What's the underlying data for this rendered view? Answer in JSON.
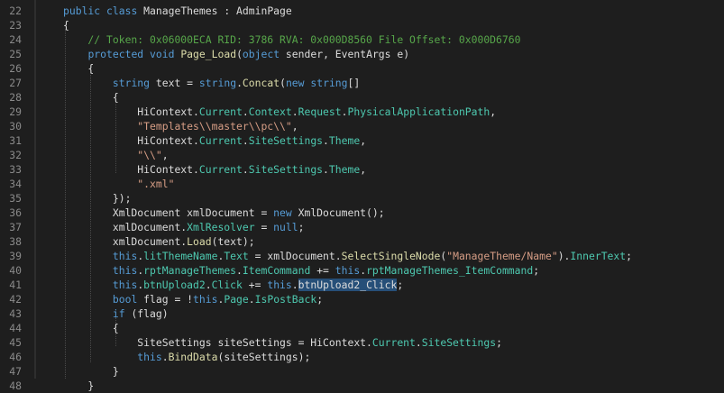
{
  "editor": {
    "line_numbers": [
      "22",
      "23",
      "24",
      "25",
      "26",
      "27",
      "28",
      "29",
      "30",
      "31",
      "32",
      "33",
      "34",
      "35",
      "36",
      "37",
      "38",
      "39",
      "40",
      "41",
      "42",
      "43",
      "44",
      "45",
      "46",
      "47",
      "48"
    ],
    "lines": [
      [
        {
          "c": "kw",
          "t": "public"
        },
        {
          "c": "txt",
          "t": " "
        },
        {
          "c": "kw",
          "t": "class"
        },
        {
          "c": "txt",
          "t": " ManageThemes : AdminPage"
        }
      ],
      [
        {
          "c": "txt",
          "t": "{"
        }
      ],
      [
        {
          "c": "cm",
          "t": "    // Token: 0x06000ECA RID: 3786 RVA: 0x000D8560 File Offset: 0x000D6760"
        }
      ],
      [
        {
          "c": "txt",
          "t": "    "
        },
        {
          "c": "kw",
          "t": "protected"
        },
        {
          "c": "txt",
          "t": " "
        },
        {
          "c": "kw",
          "t": "void"
        },
        {
          "c": "txt",
          "t": " "
        },
        {
          "c": "fn",
          "t": "Page_Load"
        },
        {
          "c": "txt",
          "t": "("
        },
        {
          "c": "kw",
          "t": "object"
        },
        {
          "c": "txt",
          "t": " sender, EventArgs e)"
        }
      ],
      [
        {
          "c": "txt",
          "t": "    {"
        }
      ],
      [
        {
          "c": "txt",
          "t": "        "
        },
        {
          "c": "kw",
          "t": "string"
        },
        {
          "c": "txt",
          "t": " text = "
        },
        {
          "c": "kw",
          "t": "string"
        },
        {
          "c": "txt",
          "t": "."
        },
        {
          "c": "fn",
          "t": "Concat"
        },
        {
          "c": "txt",
          "t": "("
        },
        {
          "c": "kw",
          "t": "new"
        },
        {
          "c": "txt",
          "t": " "
        },
        {
          "c": "kw",
          "t": "string"
        },
        {
          "c": "txt",
          "t": "[]"
        }
      ],
      [
        {
          "c": "txt",
          "t": "        {"
        }
      ],
      [
        {
          "c": "txt",
          "t": "            HiContext."
        },
        {
          "c": "mem",
          "t": "Current"
        },
        {
          "c": "txt",
          "t": "."
        },
        {
          "c": "mem",
          "t": "Context"
        },
        {
          "c": "txt",
          "t": "."
        },
        {
          "c": "mem",
          "t": "Request"
        },
        {
          "c": "txt",
          "t": "."
        },
        {
          "c": "mem",
          "t": "PhysicalApplicationPath"
        },
        {
          "c": "txt",
          "t": ","
        }
      ],
      [
        {
          "c": "txt",
          "t": "            "
        },
        {
          "c": "str",
          "t": "\"Templates\\\\master\\\\pc\\\\\""
        },
        {
          "c": "txt",
          "t": ","
        }
      ],
      [
        {
          "c": "txt",
          "t": "            HiContext."
        },
        {
          "c": "mem",
          "t": "Current"
        },
        {
          "c": "txt",
          "t": "."
        },
        {
          "c": "mem",
          "t": "SiteSettings"
        },
        {
          "c": "txt",
          "t": "."
        },
        {
          "c": "mem",
          "t": "Theme"
        },
        {
          "c": "txt",
          "t": ","
        }
      ],
      [
        {
          "c": "txt",
          "t": "            "
        },
        {
          "c": "str",
          "t": "\"\\\\\""
        },
        {
          "c": "txt",
          "t": ","
        }
      ],
      [
        {
          "c": "txt",
          "t": "            HiContext."
        },
        {
          "c": "mem",
          "t": "Current"
        },
        {
          "c": "txt",
          "t": "."
        },
        {
          "c": "mem",
          "t": "SiteSettings"
        },
        {
          "c": "txt",
          "t": "."
        },
        {
          "c": "mem",
          "t": "Theme"
        },
        {
          "c": "txt",
          "t": ","
        }
      ],
      [
        {
          "c": "txt",
          "t": "            "
        },
        {
          "c": "str",
          "t": "\".xml\""
        }
      ],
      [
        {
          "c": "txt",
          "t": "        });"
        }
      ],
      [
        {
          "c": "txt",
          "t": "        XmlDocument xmlDocument = "
        },
        {
          "c": "kw",
          "t": "new"
        },
        {
          "c": "txt",
          "t": " XmlDocument();"
        }
      ],
      [
        {
          "c": "txt",
          "t": "        xmlDocument."
        },
        {
          "c": "mem",
          "t": "XmlResolver"
        },
        {
          "c": "txt",
          "t": " = "
        },
        {
          "c": "kw",
          "t": "null"
        },
        {
          "c": "txt",
          "t": ";"
        }
      ],
      [
        {
          "c": "txt",
          "t": "        xmlDocument."
        },
        {
          "c": "fn",
          "t": "Load"
        },
        {
          "c": "txt",
          "t": "(text);"
        }
      ],
      [
        {
          "c": "txt",
          "t": "        "
        },
        {
          "c": "kw",
          "t": "this"
        },
        {
          "c": "txt",
          "t": "."
        },
        {
          "c": "mem",
          "t": "litThemeName"
        },
        {
          "c": "txt",
          "t": "."
        },
        {
          "c": "mem",
          "t": "Text"
        },
        {
          "c": "txt",
          "t": " = xmlDocument."
        },
        {
          "c": "fn",
          "t": "SelectSingleNode"
        },
        {
          "c": "txt",
          "t": "("
        },
        {
          "c": "str",
          "t": "\"ManageTheme/Name\""
        },
        {
          "c": "txt",
          "t": ")."
        },
        {
          "c": "mem",
          "t": "InnerText"
        },
        {
          "c": "txt",
          "t": ";"
        }
      ],
      [
        {
          "c": "txt",
          "t": "        "
        },
        {
          "c": "kw",
          "t": "this"
        },
        {
          "c": "txt",
          "t": "."
        },
        {
          "c": "mem",
          "t": "rptManageThemes"
        },
        {
          "c": "txt",
          "t": "."
        },
        {
          "c": "mem",
          "t": "ItemCommand"
        },
        {
          "c": "txt",
          "t": " += "
        },
        {
          "c": "kw",
          "t": "this"
        },
        {
          "c": "txt",
          "t": "."
        },
        {
          "c": "mem",
          "t": "rptManageThemes_ItemCommand"
        },
        {
          "c": "txt",
          "t": ";"
        }
      ],
      [
        {
          "c": "txt",
          "t": "        "
        },
        {
          "c": "kw",
          "t": "this"
        },
        {
          "c": "txt",
          "t": "."
        },
        {
          "c": "mem",
          "t": "btnUpload2"
        },
        {
          "c": "txt",
          "t": "."
        },
        {
          "c": "mem",
          "t": "Click"
        },
        {
          "c": "txt",
          "t": " += "
        },
        {
          "c": "kw",
          "t": "this"
        },
        {
          "c": "txt",
          "t": "."
        },
        {
          "c": "sel",
          "t": "btnUpload2_Click"
        },
        {
          "c": "txt",
          "t": ";"
        }
      ],
      [
        {
          "c": "txt",
          "t": "        "
        },
        {
          "c": "kw",
          "t": "bool"
        },
        {
          "c": "txt",
          "t": " flag = !"
        },
        {
          "c": "kw",
          "t": "this"
        },
        {
          "c": "txt",
          "t": "."
        },
        {
          "c": "mem",
          "t": "Page"
        },
        {
          "c": "txt",
          "t": "."
        },
        {
          "c": "mem",
          "t": "IsPostBack"
        },
        {
          "c": "txt",
          "t": ";"
        }
      ],
      [
        {
          "c": "txt",
          "t": "        "
        },
        {
          "c": "kw",
          "t": "if"
        },
        {
          "c": "txt",
          "t": " (flag)"
        }
      ],
      [
        {
          "c": "txt",
          "t": "        {"
        }
      ],
      [
        {
          "c": "txt",
          "t": "            SiteSettings siteSettings = HiContext."
        },
        {
          "c": "mem",
          "t": "Current"
        },
        {
          "c": "txt",
          "t": "."
        },
        {
          "c": "mem",
          "t": "SiteSettings"
        },
        {
          "c": "txt",
          "t": ";"
        }
      ],
      [
        {
          "c": "txt",
          "t": "            "
        },
        {
          "c": "kw",
          "t": "this"
        },
        {
          "c": "txt",
          "t": "."
        },
        {
          "c": "fn",
          "t": "BindData"
        },
        {
          "c": "txt",
          "t": "(siteSettings);"
        }
      ],
      [
        {
          "c": "txt",
          "t": "        }"
        }
      ],
      [
        {
          "c": "txt",
          "t": "    }"
        }
      ]
    ]
  }
}
